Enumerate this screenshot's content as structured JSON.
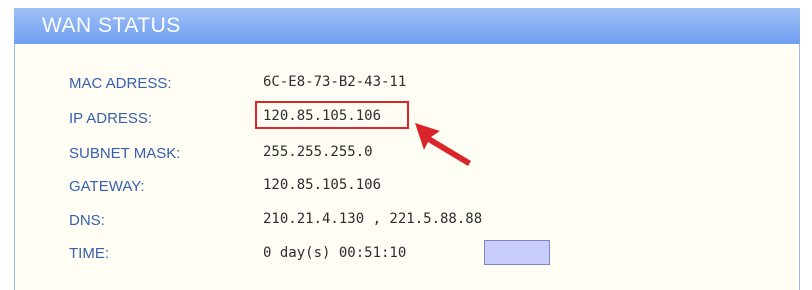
{
  "panel": {
    "title": "WAN STATUS",
    "accent_color": "#6f9ef0",
    "highlight_color": "#d8262a"
  },
  "rows": [
    {
      "label": "MAC ADRESS:",
      "value": "6C-E8-73-B2-43-11"
    },
    {
      "label": "IP ADRESS:",
      "value": "120.85.105.106"
    },
    {
      "label": "SUBNET MASK:",
      "value": "255.255.255.0"
    },
    {
      "label": "GATEWAY:",
      "value": "120.85.105.106"
    },
    {
      "label": "DNS:",
      "value": "210.21.4.130 , 221.5.88.88"
    },
    {
      "label": "TIME:",
      "value": "0 day(s) 00:51:10"
    }
  ]
}
